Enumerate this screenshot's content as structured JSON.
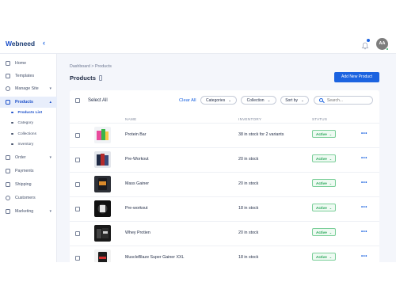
{
  "app": {
    "name_prefix": "W",
    "name_rest": "ebneed",
    "avatar_initials": "AA"
  },
  "sidebar": {
    "items": [
      {
        "label": "Home",
        "icon": "home-icon"
      },
      {
        "label": "Templates",
        "icon": "templates-icon"
      },
      {
        "label": "Manage Site",
        "icon": "globe-icon",
        "expandable": true
      },
      {
        "label": "Products",
        "icon": "tag-icon",
        "expandable": true,
        "active": true
      },
      {
        "label": "Order",
        "icon": "order-icon",
        "expandable": true
      },
      {
        "label": "Payments",
        "icon": "payments-icon"
      },
      {
        "label": "Shipping",
        "icon": "truck-icon"
      },
      {
        "label": "Customers",
        "icon": "customers-icon"
      },
      {
        "label": "Marketing",
        "icon": "megaphone-icon",
        "expandable": true
      }
    ],
    "products_sub": [
      {
        "label": "Products List",
        "active": true
      },
      {
        "label": "Category"
      },
      {
        "label": "Collections"
      },
      {
        "label": "Inventory"
      }
    ]
  },
  "breadcrumb": "Dashboard > Products",
  "page_title": "Products",
  "add_button": "Add New Product",
  "filters": {
    "select_all": "Select All",
    "clear_all": "Clear All",
    "categories": "Categories",
    "collection": "Collection",
    "sort_by": "Sort by",
    "search_placeholder": "Search..."
  },
  "table": {
    "headers": {
      "name": "NAME",
      "inventory": "INVENTORY",
      "status": "STATUS"
    },
    "rows": [
      {
        "name": "Protein Bar",
        "inventory": "38 in stock for 2 variants",
        "status": "Active",
        "thumb": "protein-bar"
      },
      {
        "name": "Pre-Workout",
        "inventory": "20 in stock",
        "status": "Active",
        "thumb": "pre-workout"
      },
      {
        "name": "Mass Gainer",
        "inventory": "20 in stock",
        "status": "Active",
        "thumb": "mass-gainer"
      },
      {
        "name": "Pre-workout",
        "inventory": "18 in stock",
        "status": "Active",
        "thumb": "pre-workout-2"
      },
      {
        "name": "Whey Protien",
        "inventory": "20 in stock",
        "status": "Active",
        "thumb": "whey-protein"
      },
      {
        "name": "MuscleBlaze Super Gainer XXL",
        "inventory": "18 in stock",
        "status": "Active",
        "thumb": "muscleblaze"
      }
    ],
    "more_glyph": "•••"
  },
  "colors": {
    "accent": "#1b63e0",
    "active_status": "#23a455"
  }
}
